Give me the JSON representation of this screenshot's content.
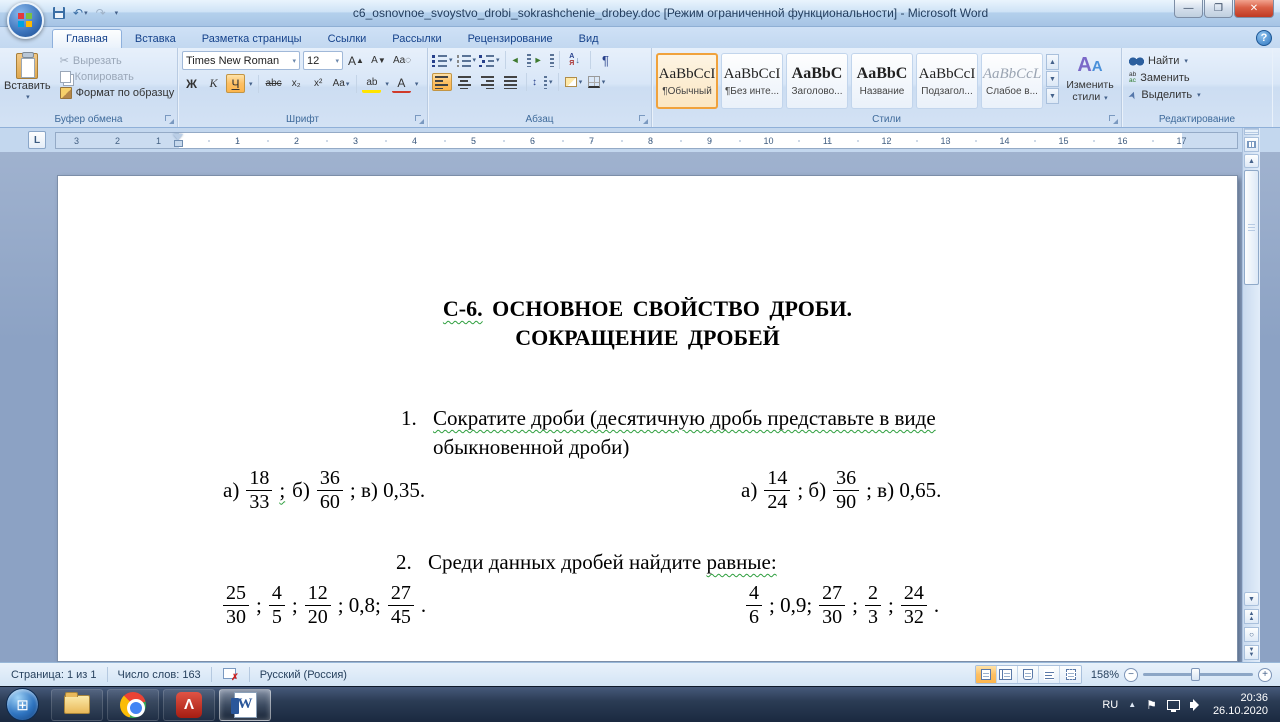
{
  "window": {
    "title": "c6_osnovnoe_svoystvo_drobi_sokrashchenie_drobey.doc [Режим ограниченной функциональности] - Microsoft Word"
  },
  "tabs": [
    {
      "label": "Главная"
    },
    {
      "label": "Вставка"
    },
    {
      "label": "Разметка страницы"
    },
    {
      "label": "Ссылки"
    },
    {
      "label": "Рассылки"
    },
    {
      "label": "Рецензирование"
    },
    {
      "label": "Вид"
    }
  ],
  "ribbon": {
    "clipboard": {
      "group_label": "Буфер обмена",
      "paste": "Вставить",
      "cut": "Вырезать",
      "copy": "Копировать",
      "format_painter": "Формат по образцу"
    },
    "font": {
      "group_label": "Шрифт",
      "family": "Times New Roman",
      "size": "12",
      "bold": "Ж",
      "italic": "К",
      "underline": "Ч",
      "strikethrough": "abc",
      "subscript": "x₂",
      "superscript": "x²",
      "case_btn": "Aa",
      "grow": "А",
      "shrink": "А",
      "highlight": "ab",
      "font_color": "А"
    },
    "paragraph": {
      "group_label": "Абзац",
      "sort_a": "А",
      "sort_b": "Я",
      "sort_arrow": "↓",
      "pilcrow": "¶",
      "spacing_arrow": "↕"
    },
    "styles": {
      "group_label": "Стили",
      "change_styles": "Изменить стили",
      "items": [
        {
          "preview": "AaBbCcI",
          "name": "¶Обычный"
        },
        {
          "preview": "AaBbCcI",
          "name": "¶Без инте..."
        },
        {
          "preview": "AaBbC",
          "name": "Заголово..."
        },
        {
          "preview": "AaBbC",
          "name": "Название"
        },
        {
          "preview": "AaBbCcI",
          "name": "Подзагол..."
        },
        {
          "preview": "AaBbCcL",
          "name": "Слабое в..."
        }
      ]
    },
    "editing": {
      "group_label": "Редактирование",
      "find": "Найти",
      "replace": "Заменить",
      "select": "Выделить"
    }
  },
  "ruler": {
    "left_numbers": [
      "3",
      "2",
      "1"
    ],
    "right_numbers": [
      "1",
      "2",
      "3",
      "4",
      "5",
      "6",
      "7",
      "8",
      "9",
      "10",
      "11",
      "12",
      "13",
      "14",
      "15",
      "16",
      "17"
    ]
  },
  "document": {
    "title_wavy": "С-6.",
    "title_rest": " ОСНОВНОЕ СВОЙСТВО ДРОБИ.",
    "title_line2": "СОКРАЩЕНИЕ ДРОБЕЙ",
    "item1_number": "1.",
    "item1_line1": "Сократите дроби (десятичную дробь представьте в виде",
    "item1_line2": "обыкновенной дроби)",
    "item2_number": "2.",
    "item2_text": "Среди данных дробей найдите",
    "item2_wavy": "равные:",
    "fraction_rows": [
      {
        "tokens": [
          {
            "t": "а)"
          },
          {
            "f": [
              "18",
              "33"
            ]
          },
          {
            "t": ";",
            "w": true
          },
          {
            "t": "б)"
          },
          {
            "f": [
              "36",
              "60"
            ]
          },
          {
            "t": "; в) 0,35."
          }
        ]
      },
      {
        "tokens": [
          {
            "t": "а)"
          },
          {
            "f": [
              "14",
              "24"
            ]
          },
          {
            "t": "; б)"
          },
          {
            "f": [
              "36",
              "90"
            ]
          },
          {
            "t": "; в) 0,65."
          }
        ]
      },
      {
        "tokens": [
          {
            "f": [
              "25",
              "30"
            ]
          },
          {
            "t": ";"
          },
          {
            "f": [
              "4",
              "5"
            ]
          },
          {
            "t": ";"
          },
          {
            "f": [
              "12",
              "20"
            ]
          },
          {
            "t": "; 0,8;"
          },
          {
            "f": [
              "27",
              "45"
            ]
          },
          {
            "t": "."
          }
        ]
      },
      {
        "tokens": [
          {
            "f": [
              "4",
              "6"
            ]
          },
          {
            "t": "; 0,9;"
          },
          {
            "f": [
              "27",
              "30"
            ]
          },
          {
            "t": ";"
          },
          {
            "f": [
              "2",
              "3"
            ]
          },
          {
            "t": ";"
          },
          {
            "f": [
              "24",
              "32"
            ]
          },
          {
            "t": "."
          }
        ]
      }
    ]
  },
  "status_bar": {
    "page": "Страница: 1 из 1",
    "words": "Число слов: 163",
    "language": "Русский (Россия)",
    "zoom_level": "158%"
  },
  "taskbar": {
    "language": "RU",
    "time": "20:36",
    "date": "26.10.2020"
  }
}
